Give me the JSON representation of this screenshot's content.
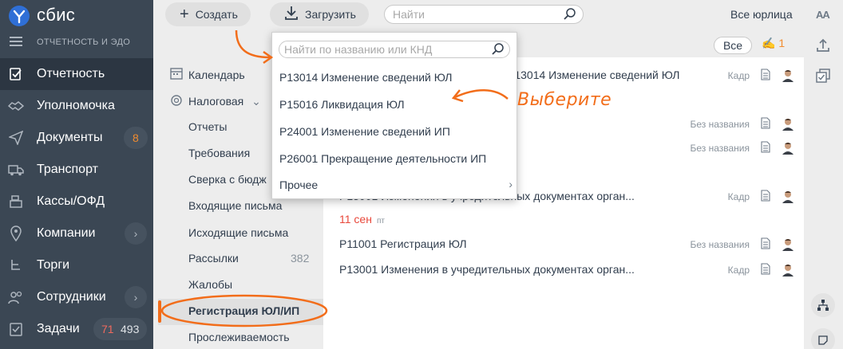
{
  "nav": {
    "brand": "сбис",
    "subtitle": "ОТЧЕТНОСТЬ И ЭДО",
    "items": [
      {
        "label": "Отчетность",
        "icon": "report-icon"
      },
      {
        "label": "Уполномочка",
        "icon": "handshake-icon"
      },
      {
        "label": "Документы",
        "icon": "send-icon",
        "count": "8"
      },
      {
        "label": "Транспорт",
        "icon": "truck-icon"
      },
      {
        "label": "Кассы/ОФД",
        "icon": "cash-register-icon"
      },
      {
        "label": "Компании",
        "icon": "location-icon"
      },
      {
        "label": "Торги",
        "icon": "gavel-icon"
      },
      {
        "label": "Сотрудники",
        "icon": "people-icon"
      },
      {
        "label": "Задачи",
        "icon": "task-icon",
        "count_red": "71",
        "count": "493"
      }
    ]
  },
  "toolbar": {
    "create_label": "Создать",
    "upload_label": "Загрузить",
    "search_placeholder": "Найти",
    "org_selector": "Все юрлица",
    "font_size": "AA"
  },
  "filters": {
    "all_label": "Все",
    "signature_count": "1"
  },
  "sidebar2": {
    "calendar": "Календарь",
    "tax": "Налоговая",
    "items": [
      "Отчеты",
      "Требования",
      "Сверка с бюдж",
      "Входящие письма",
      "Исходящие письма",
      "Рассылки",
      "Жалобы",
      "Регистрация ЮЛ/ИП",
      "Прослеживаемость"
    ],
    "mailings_count": "382",
    "selected": "Регистрация ЮЛ/ИП"
  },
  "list": {
    "rows_top": [
      {
        "title": "Р13014 Изменение сведений ЮЛ",
        "tag": "Кадр"
      },
      {
        "title": "",
        "tag": "Без названия"
      },
      {
        "title": "",
        "tag": "Без названия"
      },
      {
        "title": "Р13001 Изменения в учредительных документах орган...",
        "tag": "Кадр"
      }
    ],
    "date_header": {
      "date": "11 сен",
      "weekday": "пт"
    },
    "rows_bottom": [
      {
        "title": "Р11001 Регистрация ЮЛ",
        "tag": "Без названия"
      },
      {
        "title": "Р13001 Изменения в учредительных документах орган...",
        "tag": "Кадр"
      }
    ]
  },
  "dropdown": {
    "search_placeholder": "Найти по названию или КНД",
    "items": [
      "Р13014 Изменение сведений ЮЛ",
      "Р15016 Ликвидация ЮЛ",
      "Р24001 Изменение сведений ИП",
      "Р26001 Прекращение деятельности ИП",
      "Прочее"
    ]
  },
  "annotation": "Выберите",
  "colors": {
    "nav_bg": "#3b4754",
    "accent": "#f26d1a",
    "date_red": "#e8483b",
    "badge_orange": "#f28c2f"
  }
}
